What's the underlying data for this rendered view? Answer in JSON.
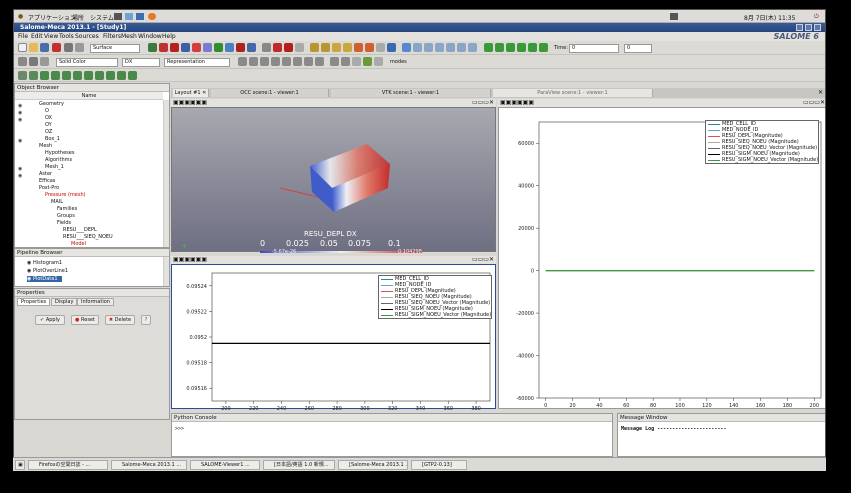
{
  "desktop": {
    "apps_menu": "アプリケーション",
    "places_menu": "場所",
    "system_menu": "システム",
    "clock": "8月 7日(木) 11:35"
  },
  "window": {
    "title": "Salome-Meca 2013.1 - [Study1]",
    "brand": "SALOME 6"
  },
  "menubar": [
    "File",
    "Edit",
    "View",
    "Tools",
    "Sources",
    "Filters",
    "Mesh",
    "Window",
    "Help"
  ],
  "toolbar": {
    "representation": "Surface",
    "solid_color": "Solid Color",
    "component": "DX",
    "rep_type": "Representation",
    "time_label": "Time:",
    "time_value": "0",
    "time_index": "0",
    "modes": "modes"
  },
  "object_browser": {
    "title": "Object Browser",
    "column": "Name",
    "items": [
      "Geometry",
      "O",
      "OX",
      "OY",
      "OZ",
      "Box_1",
      "Mesh",
      "Hypotheses",
      "Algorithms",
      "Mesh_1",
      "Aster",
      "Efficas",
      "Post-Pro",
      "Pressure (mesh)",
      "MAIL",
      "Families",
      "Groups",
      "Fields",
      "RESU___DEPL",
      "RESU___SIEQ_NOEU",
      "Model"
    ]
  },
  "pipeline_browser": {
    "title": "Pipeline Browser",
    "items": [
      "Histogram1",
      "PlotOverLine1",
      "PlotData1"
    ]
  },
  "properties": {
    "title": "Properties",
    "tabs": [
      "Properties",
      "Display",
      "Information"
    ],
    "apply": "Apply",
    "reset": "Reset",
    "delete": "Delete",
    "help": "?"
  },
  "view_tabs": [
    "Layout #1",
    "OCC scene:1 - viewer:1",
    "VTK scene:1 - viewer:1",
    "ParaView scene:1 - viewer:1"
  ],
  "scalar_bar": {
    "title": "RESU_DEPL DX",
    "ticks": [
      "0",
      "0.025",
      "0.05",
      "0.075",
      "0.1"
    ],
    "min_label": "-5.67e-26",
    "max_label": "0.104298"
  },
  "legend_entries": [
    "MED_CELL_ID",
    "MED_NODE_ID",
    "RESU_DEPL (Magnitude)",
    "RESU_SIEQ_NOEU (Magnitude)",
    "RESU_SIEQ_NOEU_Vector (Magnitude)",
    "RESU_SIGM_NOEU (Magnitude)",
    "RESU_SIGM_NOEU_Vector (Magnitude)"
  ],
  "colors": {
    "accent": "#2a4a86",
    "line_black": "#000000",
    "line_red": "#e05050",
    "line_teal": "#2b8c8c",
    "line_green": "#3d9a3d",
    "selection": "#3465a4"
  },
  "python_console": {
    "title": "Python Console",
    "prompt": ">>>"
  },
  "message_window": {
    "title": "Message Window",
    "text": "Message Log -----------------------"
  },
  "taskbar": [
    "Firefoxの空間日誌 - ...",
    "Salome-Meca 2013.1 ...",
    "SALOME-Viewer1 ...",
    "[日本語/英語 1.0 新規...",
    "[Salome-Meca 2013.1 ...",
    "[GTP2-0.13]"
  ],
  "chart_data": [
    {
      "type": "line",
      "title": "",
      "x_ticks": [
        "200",
        "220",
        "240",
        "260",
        "280",
        "300",
        "320",
        "340",
        "360",
        "380"
      ],
      "y_ticks": [
        "0.09524",
        "0.09522",
        "0.0952",
        "0.09518",
        "0.09516"
      ],
      "xlim": [
        190,
        390
      ],
      "ylim": [
        0.09515,
        0.09525
      ],
      "series": [
        {
          "name": "RESU_SIGM_NOEU_Vector (Magnitude)",
          "x": [
            190,
            390
          ],
          "y": [
            0.095195,
            0.095195
          ]
        }
      ]
    },
    {
      "type": "line",
      "title": "",
      "x_ticks": [
        "0",
        "20",
        "40",
        "60",
        "80",
        "100",
        "120",
        "140",
        "160",
        "180",
        "200"
      ],
      "y_ticks": [
        "60000",
        "40000",
        "20000",
        "0",
        "-20000",
        "-40000",
        "-60000"
      ],
      "xlim": [
        -5,
        205
      ],
      "ylim": [
        -60000,
        70000
      ],
      "series": [
        {
          "name": "MED_CELL_ID",
          "x": [
            0,
            200
          ],
          "y": [
            0,
            0
          ]
        },
        {
          "name": "RESU_SIGM_NOEU (Magnitude)",
          "x": [
            0,
            200
          ],
          "y": [
            0,
            0
          ]
        }
      ]
    }
  ]
}
